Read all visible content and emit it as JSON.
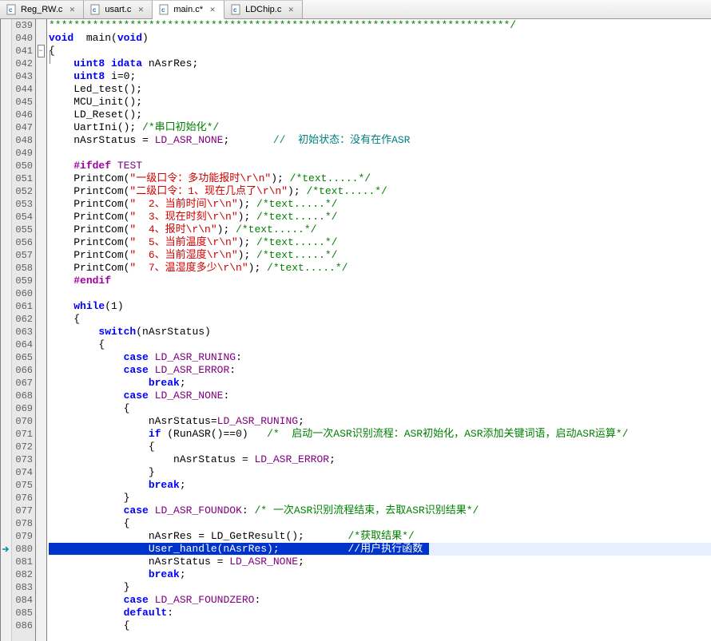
{
  "tabs": [
    {
      "label": "Reg_RW.c",
      "active": false
    },
    {
      "label": "usart.c",
      "active": false
    },
    {
      "label": "main.c*",
      "active": true
    },
    {
      "label": "LDChip.c",
      "active": false
    }
  ],
  "first_line": 39,
  "current_line": 80,
  "fold_at": 41,
  "code": [
    {
      "html": "<span class='cmt'>**************************************************************************/</span>"
    },
    {
      "html": "<span class='kw'>void</span>  main(<span class='kw'>void</span>)"
    },
    {
      "html": "{"
    },
    {
      "html": "    <span class='typ'>uint8</span> <span class='kw'>idata</span> nAsrRes;"
    },
    {
      "html": "    <span class='typ'>uint8</span> i=<span class='num'>0</span>;"
    },
    {
      "html": "    Led_test();"
    },
    {
      "html": "    MCU_init();"
    },
    {
      "html": "    LD_Reset();"
    },
    {
      "html": "    UartIni(); <span class='cmt'>/*串口初始化*/</span>"
    },
    {
      "html": "    nAsrStatus = <span class='mac'>LD_ASR_NONE</span>;       <span class='cmt2'>//  初始状态：没有在作ASR</span>"
    },
    {
      "html": "    "
    },
    {
      "html": "    <span class='pp'>#ifdef</span> <span class='mac'>TEST</span>"
    },
    {
      "html": "    PrintCom(<span class='str'>\"一级口令：多功能报时\\r\\n\"</span>); <span class='cmt'>/*text.....*/</span>"
    },
    {
      "html": "    PrintCom(<span class='str'>\"二级口令：1、现在几点了\\r\\n\"</span>); <span class='cmt'>/*text.....*/</span>"
    },
    {
      "html": "    PrintCom(<span class='str'>\"  2、当前时间\\r\\n\"</span>); <span class='cmt'>/*text.....*/</span>"
    },
    {
      "html": "    PrintCom(<span class='str'>\"  3、现在时刻\\r\\n\"</span>); <span class='cmt'>/*text.....*/</span>"
    },
    {
      "html": "    PrintCom(<span class='str'>\"  4、报时\\r\\n\"</span>); <span class='cmt'>/*text.....*/</span>"
    },
    {
      "html": "    PrintCom(<span class='str'>\"  5、当前温度\\r\\n\"</span>); <span class='cmt'>/*text.....*/</span>"
    },
    {
      "html": "    PrintCom(<span class='str'>\"  6、当前湿度\\r\\n\"</span>); <span class='cmt'>/*text.....*/</span>"
    },
    {
      "html": "    PrintCom(<span class='str'>\"  7、温湿度多少\\r\\n\"</span>); <span class='cmt'>/*text.....*/</span>"
    },
    {
      "html": "    <span class='pp'>#endif</span>"
    },
    {
      "html": ""
    },
    {
      "html": "    <span class='kw'>while</span>(<span class='num'>1</span>)"
    },
    {
      "html": "    {"
    },
    {
      "html": "        <span class='kw'>switch</span>(nAsrStatus)"
    },
    {
      "html": "        {"
    },
    {
      "html": "            <span class='kw'>case</span> <span class='mac'>LD_ASR_RUNING</span>:"
    },
    {
      "html": "            <span class='kw'>case</span> <span class='mac'>LD_ASR_ERROR</span>:"
    },
    {
      "html": "                <span class='kw'>break</span>;"
    },
    {
      "html": "            <span class='kw'>case</span> <span class='mac'>LD_ASR_NONE</span>:"
    },
    {
      "html": "            {"
    },
    {
      "html": "                nAsrStatus=<span class='mac'>LD_ASR_RUNING</span>;"
    },
    {
      "html": "                <span class='kw'>if</span> (RunASR()==<span class='num'>0</span>)   <span class='cmt'>/*  启动一次ASR识别流程：ASR初始化，ASR添加关键词语，启动ASR运算*/</span>"
    },
    {
      "html": "                {"
    },
    {
      "html": "                    nAsrStatus = <span class='mac'>LD_ASR_ERROR</span>;"
    },
    {
      "html": "                }"
    },
    {
      "html": "                <span class='kw'>break</span>;"
    },
    {
      "html": "            }"
    },
    {
      "html": "            <span class='kw'>case</span> <span class='mac'>LD_ASR_FOUNDOK</span>: <span class='cmt'>/* 一次ASR识别流程结束，去取ASR识别结果*/</span>"
    },
    {
      "html": "            {"
    },
    {
      "html": "                nAsrRes = LD_GetResult();       <span class='cmt'>/*获取结果*/</span>"
    },
    {
      "html": "<span class='selection'>                User_handle(nAsrRes);           //用户执行函数 </span>",
      "cur": true
    },
    {
      "html": "                nAsrStatus = <span class='mac'>LD_ASR_NONE</span>;"
    },
    {
      "html": "                <span class='kw'>break</span>;"
    },
    {
      "html": "            }"
    },
    {
      "html": "            <span class='kw'>case</span> <span class='mac'>LD_ASR_FOUNDZERO</span>:"
    },
    {
      "html": "            <span class='kw'>default</span>:"
    },
    {
      "html": "            {"
    }
  ]
}
